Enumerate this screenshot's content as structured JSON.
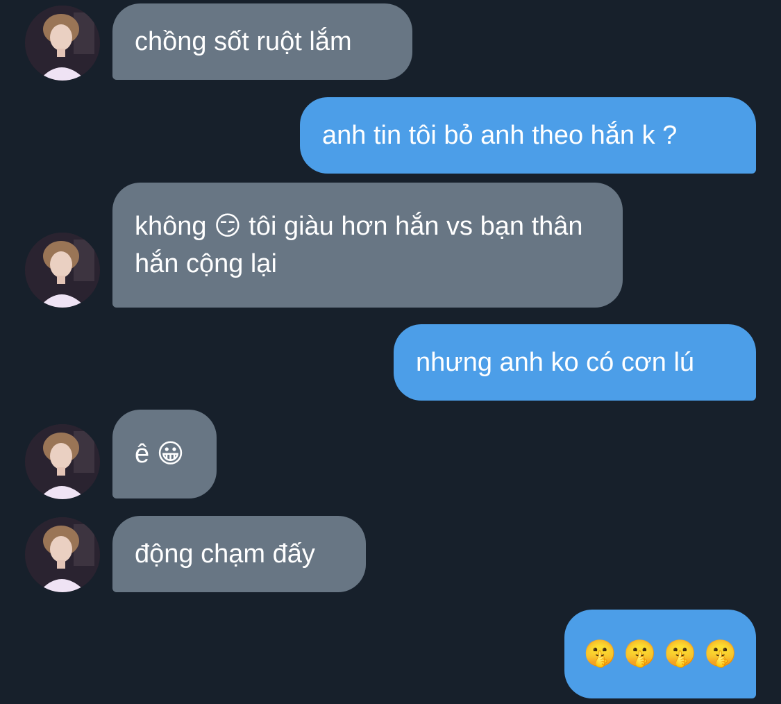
{
  "conversation": {
    "messages": [
      {
        "direction": "incoming",
        "text": "chồng sốt ruột lắm"
      },
      {
        "direction": "outgoing",
        "text": "anh tin tôi bỏ anh theo hắn k ?"
      },
      {
        "direction": "incoming",
        "text": "không 😏 tôi giàu hơn hắn vs bạn thân hắn cộng lại"
      },
      {
        "direction": "outgoing",
        "text": "nhưng anh ko có cơn lú"
      },
      {
        "direction": "incoming",
        "text": "ê 😀"
      },
      {
        "direction": "incoming",
        "text": "động chạm đấy"
      },
      {
        "direction": "outgoing",
        "text": "🤫 🤫 🤫 🤫"
      }
    ]
  },
  "colors": {
    "background": "#17202b",
    "incoming_bubble": "#687684",
    "outgoing_bubble": "#4c9ee8",
    "text": "#ffffff"
  },
  "icons": {
    "avatar": "contact-avatar-photo"
  }
}
